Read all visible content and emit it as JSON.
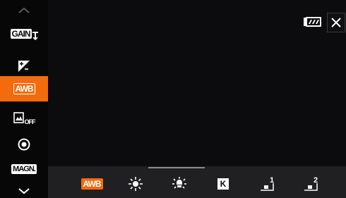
{
  "sidebar": {
    "items": [
      {
        "label": "GAIN",
        "icon": "gain-down-icon"
      },
      {
        "label": "",
        "icon": "exposure-compensation-icon"
      },
      {
        "label": "AWB",
        "icon": "white-balance-icon",
        "active": true
      },
      {
        "label": "OFF",
        "icon": "picture-style-off-icon"
      },
      {
        "label": "",
        "icon": "focus-icon"
      },
      {
        "label": "MAGN.",
        "icon": "magnification-icon"
      }
    ]
  },
  "bottom_bar": {
    "options": [
      {
        "label": "AWB",
        "icon": "auto-white-balance-icon",
        "selected": true
      },
      {
        "label": "",
        "icon": "daylight-icon"
      },
      {
        "label": "",
        "icon": "tungsten-light-icon"
      },
      {
        "label": "K",
        "icon": "kelvin-icon"
      },
      {
        "label": "1",
        "icon": "custom-wb-1-icon"
      },
      {
        "label": "2",
        "icon": "custom-wb-2-icon"
      }
    ]
  },
  "status": {
    "battery_icon": "battery-icon"
  },
  "colors": {
    "accent": "#f26b0c",
    "bar": "#202022",
    "background": "#0c0c0e"
  }
}
